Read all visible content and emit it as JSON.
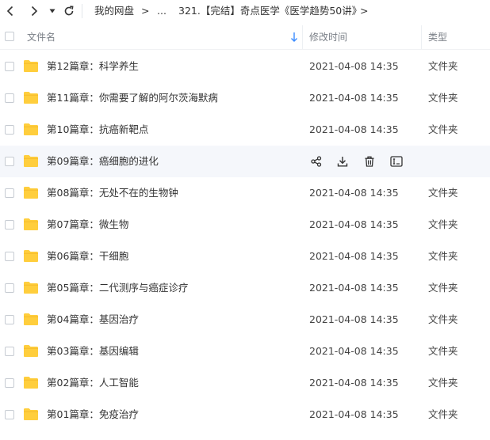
{
  "toolbar": {
    "back_icon": "chevron-left-icon",
    "forward_icon": "chevron-right-icon",
    "history_icon": "caret-down-icon",
    "refresh_icon": "refresh-icon",
    "breadcrumb": [
      "我的网盘",
      "...",
      "321.【完结】奇点医学《医学趋势50讲》"
    ],
    "separator": ">"
  },
  "table": {
    "headers": {
      "name": "文件名",
      "modified": "修改时间",
      "type": "类型"
    },
    "sort_icon": "arrow-down-icon",
    "accent_color": "#3b8cff",
    "folder_color": "#ffce3d",
    "rows": [
      {
        "name": "第12篇章：科学养生",
        "date": "2021-04-08 14:35",
        "type": "文件夹"
      },
      {
        "name": "第11篇章：你需要了解的阿尔茨海默病",
        "date": "2021-04-08 14:35",
        "type": "文件夹"
      },
      {
        "name": "第10篇章：抗癌新靶点",
        "date": "2021-04-08 14:35",
        "type": "文件夹"
      },
      {
        "name": "第09篇章：癌细胞的进化",
        "date": "",
        "type": "",
        "hovered": true,
        "actions": [
          "share-icon",
          "download-icon",
          "delete-icon",
          "rename-icon"
        ]
      },
      {
        "name": "第08篇章：无处不在的生物钟",
        "date": "2021-04-08 14:35",
        "type": "文件夹"
      },
      {
        "name": "第07篇章：微生物",
        "date": "2021-04-08 14:35",
        "type": "文件夹"
      },
      {
        "name": "第06篇章：干细胞",
        "date": "2021-04-08 14:35",
        "type": "文件夹"
      },
      {
        "name": "第05篇章：二代测序与癌症诊疗",
        "date": "2021-04-08 14:35",
        "type": "文件夹"
      },
      {
        "name": "第04篇章：基因治疗",
        "date": "2021-04-08 14:35",
        "type": "文件夹"
      },
      {
        "name": "第03篇章：基因编辑",
        "date": "2021-04-08 14:35",
        "type": "文件夹"
      },
      {
        "name": "第02篇章：人工智能",
        "date": "2021-04-08 14:35",
        "type": "文件夹"
      },
      {
        "name": "第01篇章：免疫治疗",
        "date": "2021-04-08 14:35",
        "type": "文件夹"
      }
    ]
  }
}
